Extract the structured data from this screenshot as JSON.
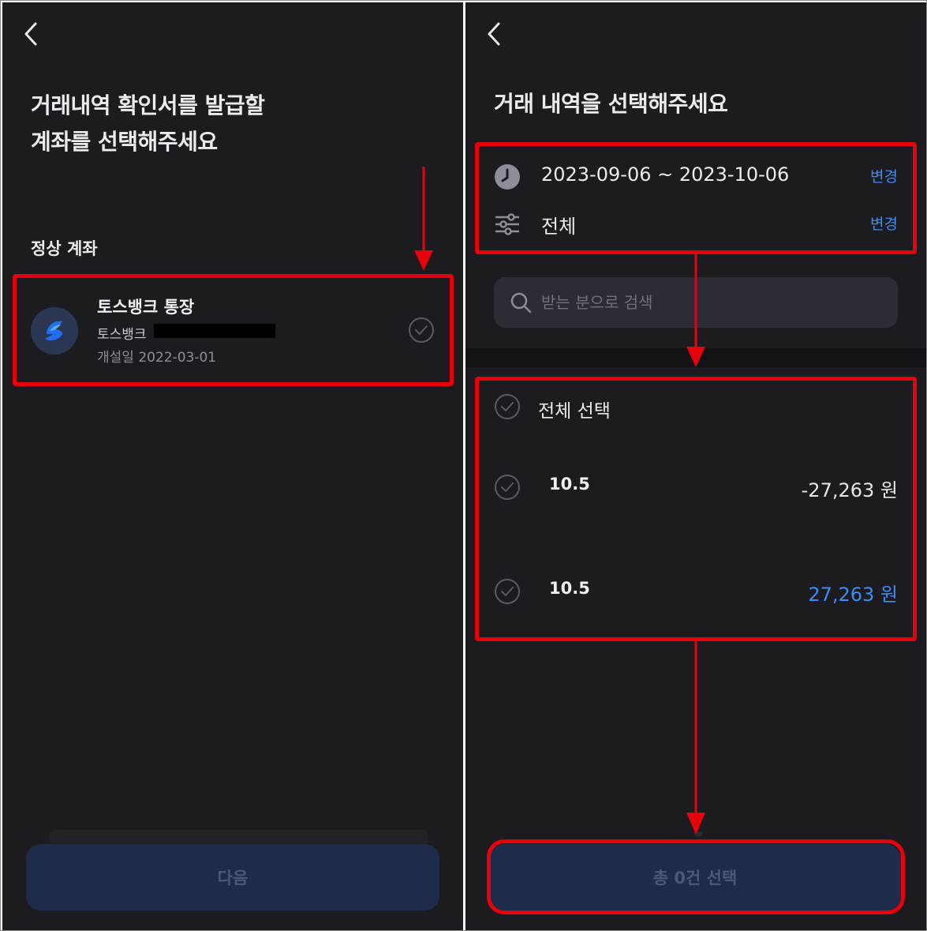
{
  "left_screen": {
    "title": "거래내역 확인서를 발급할\n계좌를 선택해주세요",
    "section_label": "정상 계좌",
    "account": {
      "name": "토스뱅크 통장",
      "bank": "토스뱅크",
      "opened": "개설일 2022-03-01",
      "logo_icon": "tossbank-logo-icon"
    },
    "next_button": "다음"
  },
  "right_screen": {
    "title": "거래 내역을 선택해주세요",
    "date_range": "2023-09-06 ~ 2023-10-06",
    "date_change": "변경",
    "type_filter": "전체",
    "type_change": "변경",
    "search_placeholder": "받는 분으로 검색",
    "select_all": "전체 선택",
    "transactions": [
      {
        "date": "10.5",
        "amount": "-27,263 원",
        "color": "#e6e6ea"
      },
      {
        "date": "10.5",
        "amount": "27,263 원",
        "color": "#3d8cf2"
      }
    ],
    "total_button": "총 0건 선택"
  },
  "colors": {
    "background": "#1b1b20",
    "accent_blue": "#3d8cf2",
    "button_bg": "#1e2b4a",
    "button_text": "#4d5878",
    "annotation_red": "#e8000b"
  }
}
